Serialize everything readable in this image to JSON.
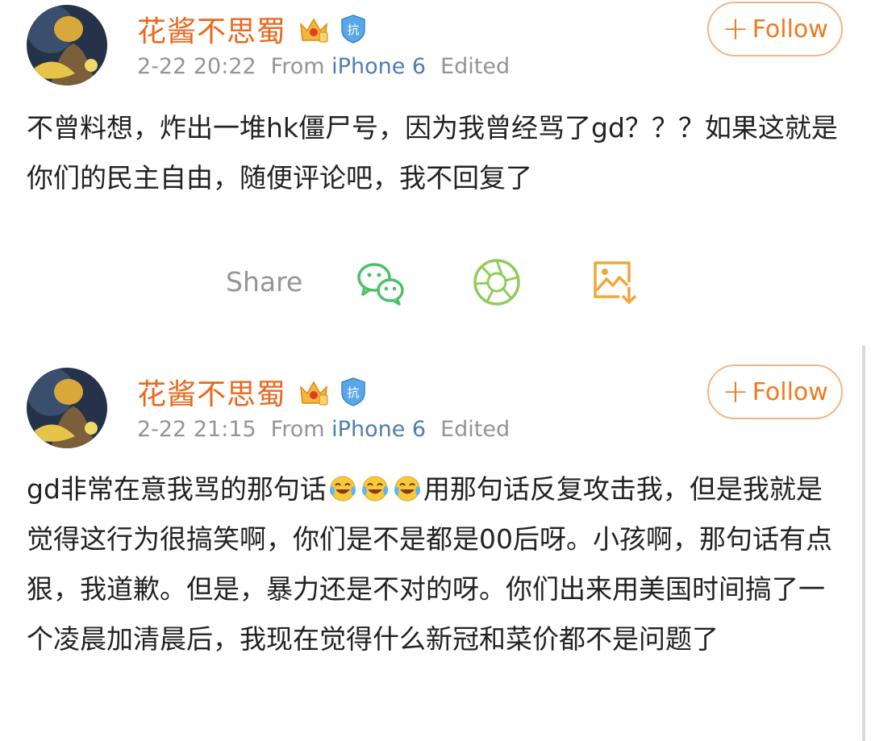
{
  "posts": [
    {
      "username": "花酱不思蜀",
      "timestamp": "2-22 20:22",
      "from_label": "From",
      "device": "iPhone 6",
      "edited": "Edited",
      "follow_label": "Follow",
      "text": "不曾料想，炸出一堆hk僵尸号，因为我曾经骂了gd？？？如果这就是你们的民主自由，随便评论吧，我不回复了"
    },
    {
      "username": "花酱不思蜀",
      "timestamp": "2-22 21:15",
      "from_label": "From",
      "device": "iPhone 6",
      "edited": "Edited",
      "follow_label": "Follow",
      "text_before_emoji": "gd非常在意我骂的那句话",
      "emoji_count": 3,
      "emoji_name": "laugh-cry-emoji",
      "text_after_emoji": "用那句话反复攻击我，但是我就是觉得这行为很搞笑啊，你们是不是都是00后呀。小孩啊，那句话有点狠，我道歉。但是，暴力还是不对的呀。你们出来用美国时间搞了一个凌晨加清晨后，我现在觉得什么新冠和菜价都不是问题了"
    }
  ],
  "badges": {
    "crown_char": "E",
    "shield_char": "抗"
  },
  "share": {
    "label": "Share",
    "icons": [
      "wechat-icon",
      "moments-icon",
      "save-image-icon"
    ]
  },
  "colors": {
    "username": "#e8691e",
    "device": "#507daf",
    "meta": "#959595",
    "follow": "#ee7a1f",
    "wechat": "#4dc06a",
    "moments": "#8fcc5c",
    "save": "#f0a73a"
  }
}
